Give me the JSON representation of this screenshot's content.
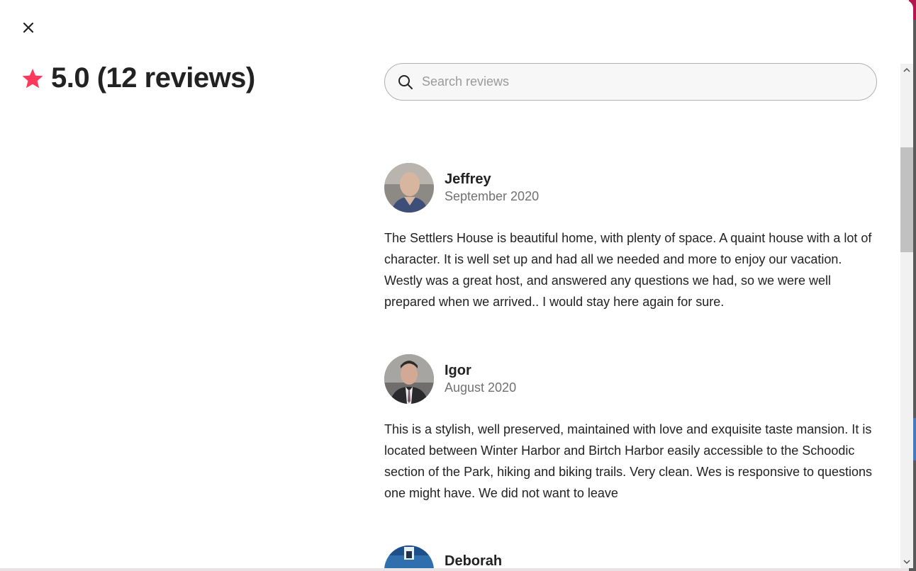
{
  "dialog": {
    "close_label": "Close",
    "rating_text": "5.0 (12 reviews)",
    "accent_color": "#ff385c"
  },
  "search": {
    "placeholder": "Search reviews",
    "value": ""
  },
  "reviews": [
    {
      "name": "Jeffrey",
      "date": "September 2020",
      "text": "The Settlers House is beautiful home, with plenty of space. A quaint house with a lot of character. It is well set up and had all we needed and more to enjoy our vacation. Westly was a great host, and answered any questions we had, so we were well prepared when we arrived.. I would stay here again for sure."
    },
    {
      "name": "Igor",
      "date": "August 2020",
      "text": "This is a stylish, well preserved, maintained with love and exquisite taste mansion. It is located between Winter Harbor and Birtch Harbor easily accessible to the Schoodic section of the Park, hiking and biking trails. Very clean. Wes is responsive to questions one might have. We did not want to leave"
    },
    {
      "name": "Deborah",
      "date": "",
      "text": ""
    }
  ],
  "icons": {
    "close": "close-icon",
    "star": "star-icon",
    "search": "search-icon",
    "scroll_up": "chevron-up-icon",
    "scroll_down": "chevron-down-icon"
  }
}
